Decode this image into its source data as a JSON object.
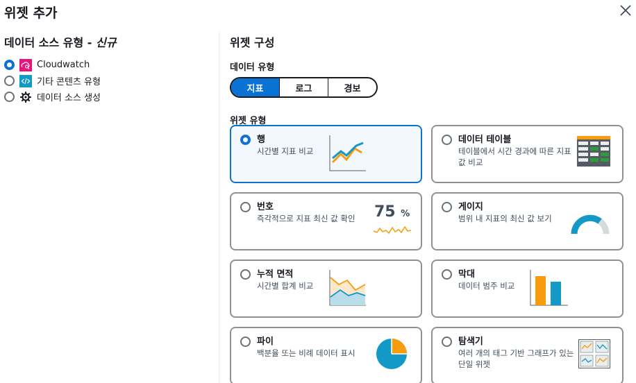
{
  "header": {
    "title": "위젯 추가"
  },
  "left": {
    "heading": "데이터 소스 유형 - ",
    "heading_italic": "신규",
    "sources": [
      {
        "label": "Cloudwatch",
        "icon": "cloudwatch-icon",
        "selected": true
      },
      {
        "label": "기타 콘텐츠 유형",
        "icon": "code-icon",
        "selected": false
      },
      {
        "label": "데이터 소스 생성",
        "icon": "gear-icon",
        "selected": false
      }
    ]
  },
  "right": {
    "heading": "위젯 구성",
    "data_type_label": "데이터 유형",
    "data_types": [
      {
        "label": "지표",
        "selected": true
      },
      {
        "label": "로그",
        "selected": false
      },
      {
        "label": "경보",
        "selected": false
      }
    ],
    "widget_type_label": "위젯 유형",
    "widgets": [
      {
        "title": "행",
        "desc": "시간별 지표 비교",
        "selected": true
      },
      {
        "title": "데이터 테이블",
        "desc": "테이블에서 시간 경과에 따른 지표 값 비교",
        "selected": false
      },
      {
        "title": "번호",
        "desc": "즉각적으로 지표 최신 값 확인",
        "selected": false,
        "value": "75",
        "unit": "%"
      },
      {
        "title": "게이지",
        "desc": "범위 내 지표의 최신 값 보기",
        "selected": false
      },
      {
        "title": "누적 면적",
        "desc": "시간별 합계 비교",
        "selected": false
      },
      {
        "title": "막대",
        "desc": "데이터 범주 비교",
        "selected": false
      },
      {
        "title": "파이",
        "desc": "백분율 또는 비례 데이터 표시",
        "selected": false
      },
      {
        "title": "탐색기",
        "desc": "여러 개의 태그 기반 그래프가 있는 단일 위젯",
        "selected": false
      }
    ]
  },
  "colors": {
    "accent": "#0972d3",
    "orange": "#f89c0e",
    "teal": "#1399c6"
  }
}
